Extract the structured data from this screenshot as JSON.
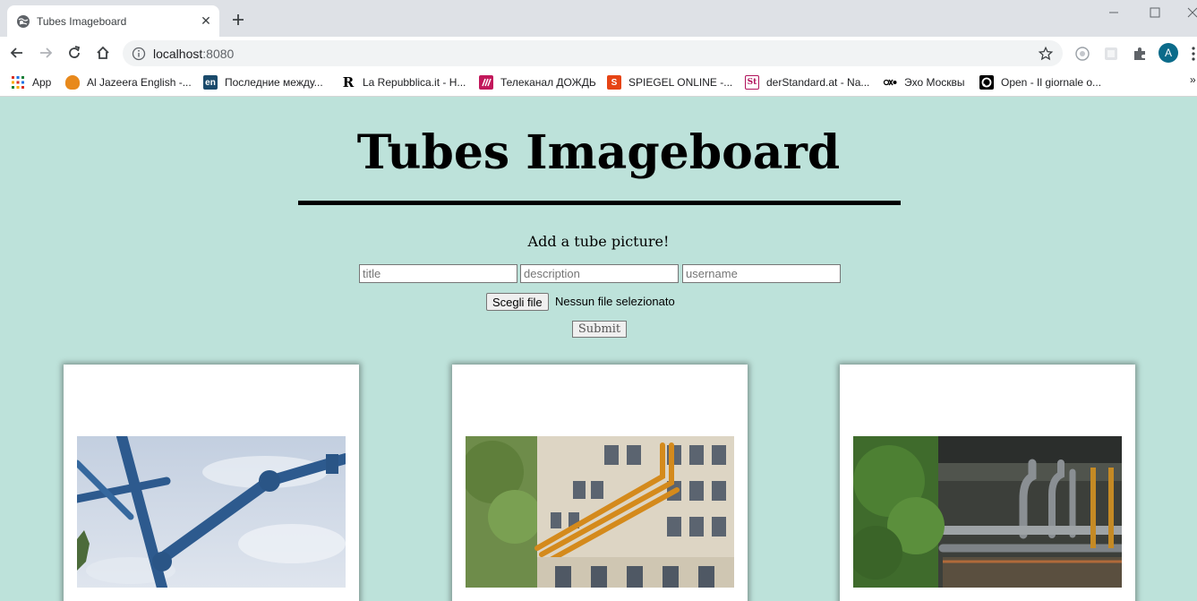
{
  "browser": {
    "tab_title": "Tubes Imageboard",
    "url_host": "localhost",
    "url_port": ":8080",
    "avatar_letter": "A",
    "bookmarks": [
      {
        "label": "App",
        "icon": "apps-grid-icon"
      },
      {
        "label": "Al Jazeera English -...",
        "icon": "aljazeera-icon",
        "color": "#e8891c"
      },
      {
        "label": "Последние между...",
        "icon": "euronews-icon",
        "color": "#1a4a6b",
        "badge": "en"
      },
      {
        "label": "La Repubblica.it - H...",
        "icon": "repubblica-icon",
        "color": "#000000",
        "badge": "R"
      },
      {
        "label": "Телеканал ДОЖДЬ",
        "icon": "dozhd-icon",
        "color": "#c2185b"
      },
      {
        "label": "SPIEGEL ONLINE -...",
        "icon": "spiegel-icon",
        "color": "#e64415",
        "badge": "S"
      },
      {
        "label": "derStandard.at - Na...",
        "icon": "derstandard-icon",
        "color": "#b0125b",
        "badge": "St"
      },
      {
        "label": "Эхо Москвы",
        "icon": "echo-moskvy-icon",
        "color": "#000000"
      },
      {
        "label": "Open - Il giornale o...",
        "icon": "open-icon",
        "color": "#000000"
      }
    ],
    "bookmarks_more": "»"
  },
  "page": {
    "title": "Tubes Imageboard",
    "form_heading": "Add a tube picture!",
    "inputs": {
      "title_placeholder": "title",
      "description_placeholder": "description",
      "username_placeholder": "username"
    },
    "file_button_label": "Scegli file",
    "file_status": "Nessun file selezionato",
    "submit_label": "Submit"
  },
  "cards": [
    {
      "image": "blue-pipes-sky-photo"
    },
    {
      "image": "orange-pipe-building-photo"
    },
    {
      "image": "steel-pipes-underpass-photo"
    }
  ],
  "colors": {
    "page_background": "#bde2da",
    "avatar": "#0b6b8a"
  }
}
